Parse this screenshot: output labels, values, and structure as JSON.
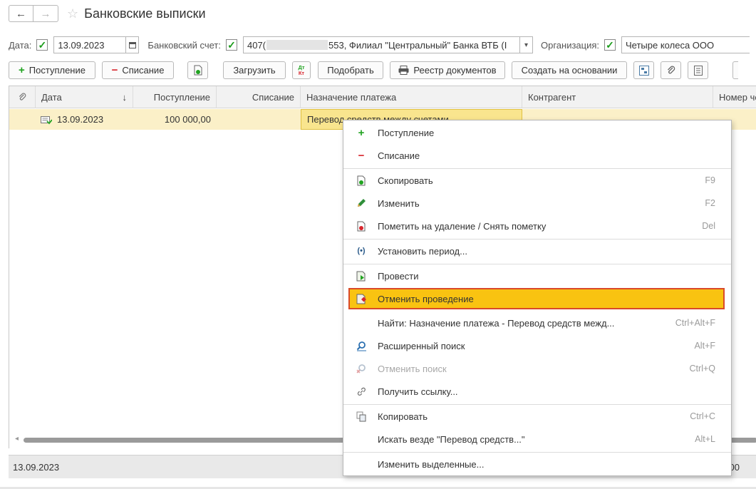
{
  "window": {
    "title": "Банковские выписки",
    "back_icon": "←",
    "forward_icon": "→",
    "star_icon": "☆"
  },
  "filters": {
    "date_label": "Дата:",
    "date_value": "13.09.2023",
    "account_label": "Банковский счет:",
    "account_value_start": "407(",
    "account_value_end": "553, Филиал \"Центральный\" Банка ВТБ (I",
    "org_label": "Организация:",
    "org_value": "Четыре колеса ООО"
  },
  "toolbar": {
    "income_label": "Поступление",
    "expense_label": "Списание",
    "load_label": "Загрузить",
    "dtkt_label_top": "Дт",
    "dtkt_label_bottom": "Кт",
    "select_label": "Подобрать",
    "registry_label": "Реестр документов",
    "create_based_label": "Создать на основании"
  },
  "table": {
    "columns": [
      "Дата",
      "Поступление",
      "Списание",
      "Назначение платежа",
      "Контрагент",
      "Номер че"
    ],
    "sort_icon": "↓",
    "rows": [
      {
        "date": "13.09.2023",
        "income": "100 000,00",
        "expense": "",
        "purpose": "Перевод средств между счетами",
        "counterparty": "",
        "number": ""
      }
    ]
  },
  "footer": {
    "date": "13.09.2023",
    "number_fragment": "00"
  },
  "context_menu": {
    "items": [
      {
        "label": "Поступление",
        "shortcut": ""
      },
      {
        "label": "Списание",
        "shortcut": ""
      },
      {
        "label": "Скопировать",
        "shortcut": "F9"
      },
      {
        "label": "Изменить",
        "shortcut": "F2"
      },
      {
        "label": "Пометить на удаление / Снять пометку",
        "shortcut": "Del"
      },
      {
        "label": "Установить период...",
        "shortcut": ""
      },
      {
        "label": "Провести",
        "shortcut": ""
      },
      {
        "label": "Отменить проведение",
        "shortcut": ""
      },
      {
        "label": "Найти: Назначение платежа - Перевод средств межд...",
        "shortcut": "Ctrl+Alt+F"
      },
      {
        "label": "Расширенный поиск",
        "shortcut": "Alt+F"
      },
      {
        "label": "Отменить поиск",
        "shortcut": "Ctrl+Q"
      },
      {
        "label": "Получить ссылку...",
        "shortcut": ""
      },
      {
        "label": "Копировать",
        "shortcut": "Ctrl+C"
      },
      {
        "label": "Искать везде \"Перевод средств...\"",
        "shortcut": "Alt+L"
      },
      {
        "label": "Изменить выделенные...",
        "shortcut": ""
      }
    ],
    "period_icon": "(•)"
  },
  "colors": {
    "highlight_fill": "#f9c311",
    "highlight_border": "#d94a2a",
    "row_selected": "#fbf0c8",
    "accent_green": "#21a321",
    "accent_red": "#d8262d"
  }
}
